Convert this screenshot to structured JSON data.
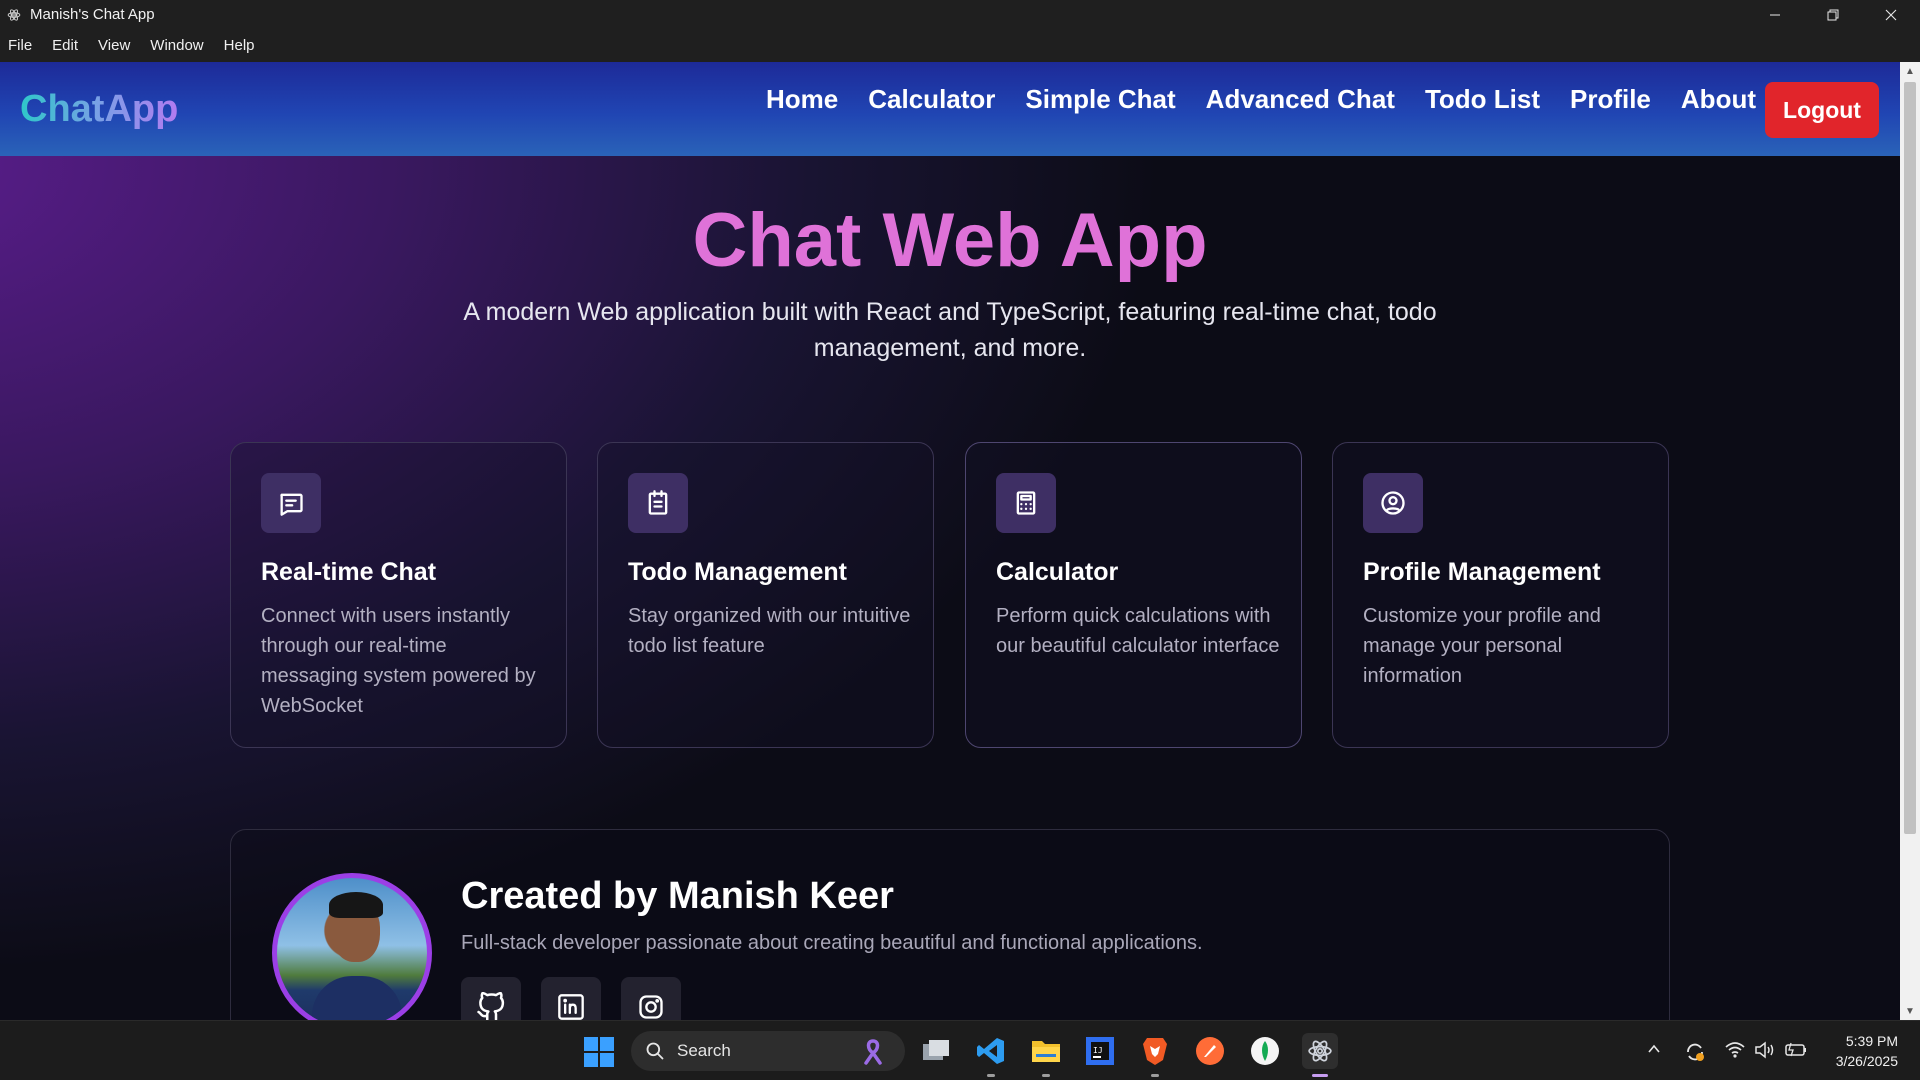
{
  "window": {
    "title": "Manish's Chat App",
    "menu": [
      "File",
      "Edit",
      "View",
      "Window",
      "Help"
    ]
  },
  "navbar": {
    "brand": "ChatApp",
    "links": [
      "Home",
      "Calculator",
      "Simple Chat",
      "Advanced Chat",
      "Todo List",
      "Profile",
      "About"
    ],
    "logout_label": "Logout"
  },
  "hero": {
    "title": "Chat Web App",
    "subtitle": "A modern Web application built with React and TypeScript, featuring real-time chat, todo management, and more."
  },
  "features": [
    {
      "icon": "message-square-icon",
      "title": "Real-time Chat",
      "description": "Connect with users instantly through our real-time messaging system powered by WebSocket"
    },
    {
      "icon": "clipboard-list-icon",
      "title": "Todo Management",
      "description": "Stay organized with our intuitive todo list feature"
    },
    {
      "icon": "calculator-icon",
      "title": "Calculator",
      "description": "Perform quick calculations with our beautiful calculator interface"
    },
    {
      "icon": "user-circle-icon",
      "title": "Profile Management",
      "description": "Customize your profile and manage your personal information"
    }
  ],
  "creator": {
    "heading": "Created by Manish Keer",
    "bio": "Full-stack developer passionate about creating beautiful and functional applications.",
    "socials": [
      "github-icon",
      "linkedin-icon",
      "instagram-icon"
    ]
  },
  "taskbar": {
    "search_label": "Search",
    "apps": [
      "file-explorer-icon",
      "vscode-icon",
      "folder-icon",
      "intellij-icon",
      "brave-icon",
      "postman-icon",
      "mongodb-icon",
      "electron-app-icon"
    ],
    "time": "5:39 PM",
    "date": "3/26/2025"
  },
  "colors": {
    "accent_title": "#df72d8",
    "logout": "#e1252b",
    "nav_gradient_start": "#1d2a98",
    "nav_gradient_end": "#2a63b8"
  }
}
